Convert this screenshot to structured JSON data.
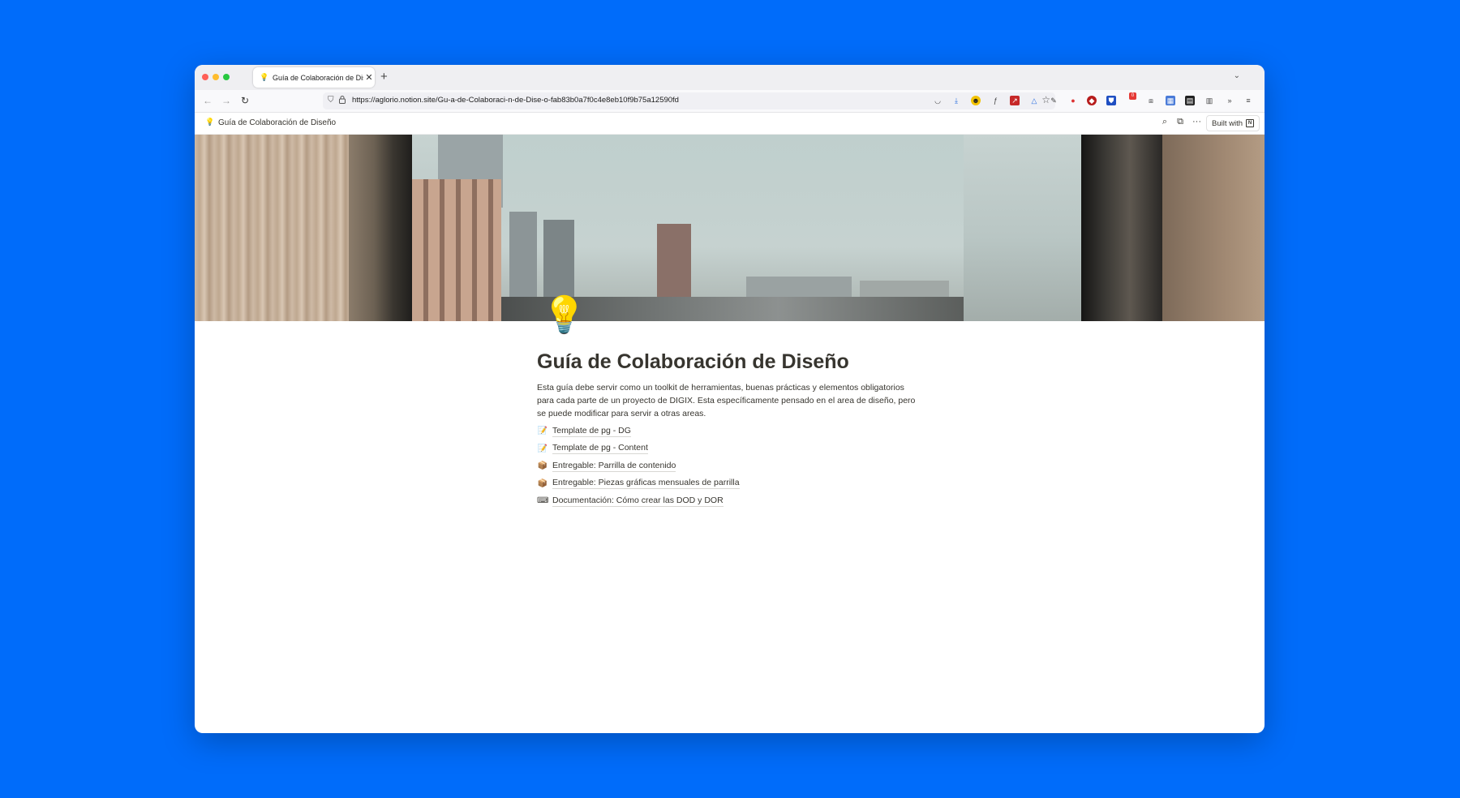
{
  "browser": {
    "tab_title": "Guía de Colaboración de Diseño",
    "tab_favicon": "💡",
    "tab_close": "✕",
    "new_tab": "+",
    "tab_list": "⌄",
    "back": "←",
    "forward": "→",
    "reload": "↻",
    "url": "https://aglorio.notion.site/Gu-a-de-Colaboraci-n-de-Dise-o-fab83b0a7f0c4e8eb10f9b75a12590fd",
    "bookmark_star": "☆",
    "extensions_badge": "0"
  },
  "notion_bar": {
    "page_icon": "💡",
    "page_title": "Guía de Colaboración de Diseño",
    "search": "⌕",
    "duplicate": "⧉",
    "more": "···",
    "built_with": "Built with",
    "notion_logo": "N"
  },
  "page": {
    "icon": "💡",
    "title": "Guía de Colaboración de Diseño",
    "description": "Esta guía debe servir como un toolkit de herramientas, buenas prácticas y elementos obligatorios para cada parte de un proyecto de DIGIX. Esta específicamente pensado en el area de diseño, pero se puede modificar para servir a otras areas.",
    "links": [
      {
        "icon": "📝",
        "icon_name": "memo-icon",
        "label": "Template de pg - DG"
      },
      {
        "icon": "📝",
        "icon_name": "memo-icon",
        "label": "Template de pg - Content"
      },
      {
        "icon": "📦",
        "icon_name": "package-icon",
        "label": "Entregable: Parrilla de contenido"
      },
      {
        "icon": "📦",
        "icon_name": "package-icon",
        "label": "Entregable: Piezas gráficas mensuales de parrilla"
      },
      {
        "icon": "⌨",
        "icon_name": "keyboard-icon",
        "label": "Documentación: Cómo crear las DOD y DOR"
      }
    ]
  },
  "colors": {
    "background": "#006cfa",
    "text": "#37352f"
  }
}
